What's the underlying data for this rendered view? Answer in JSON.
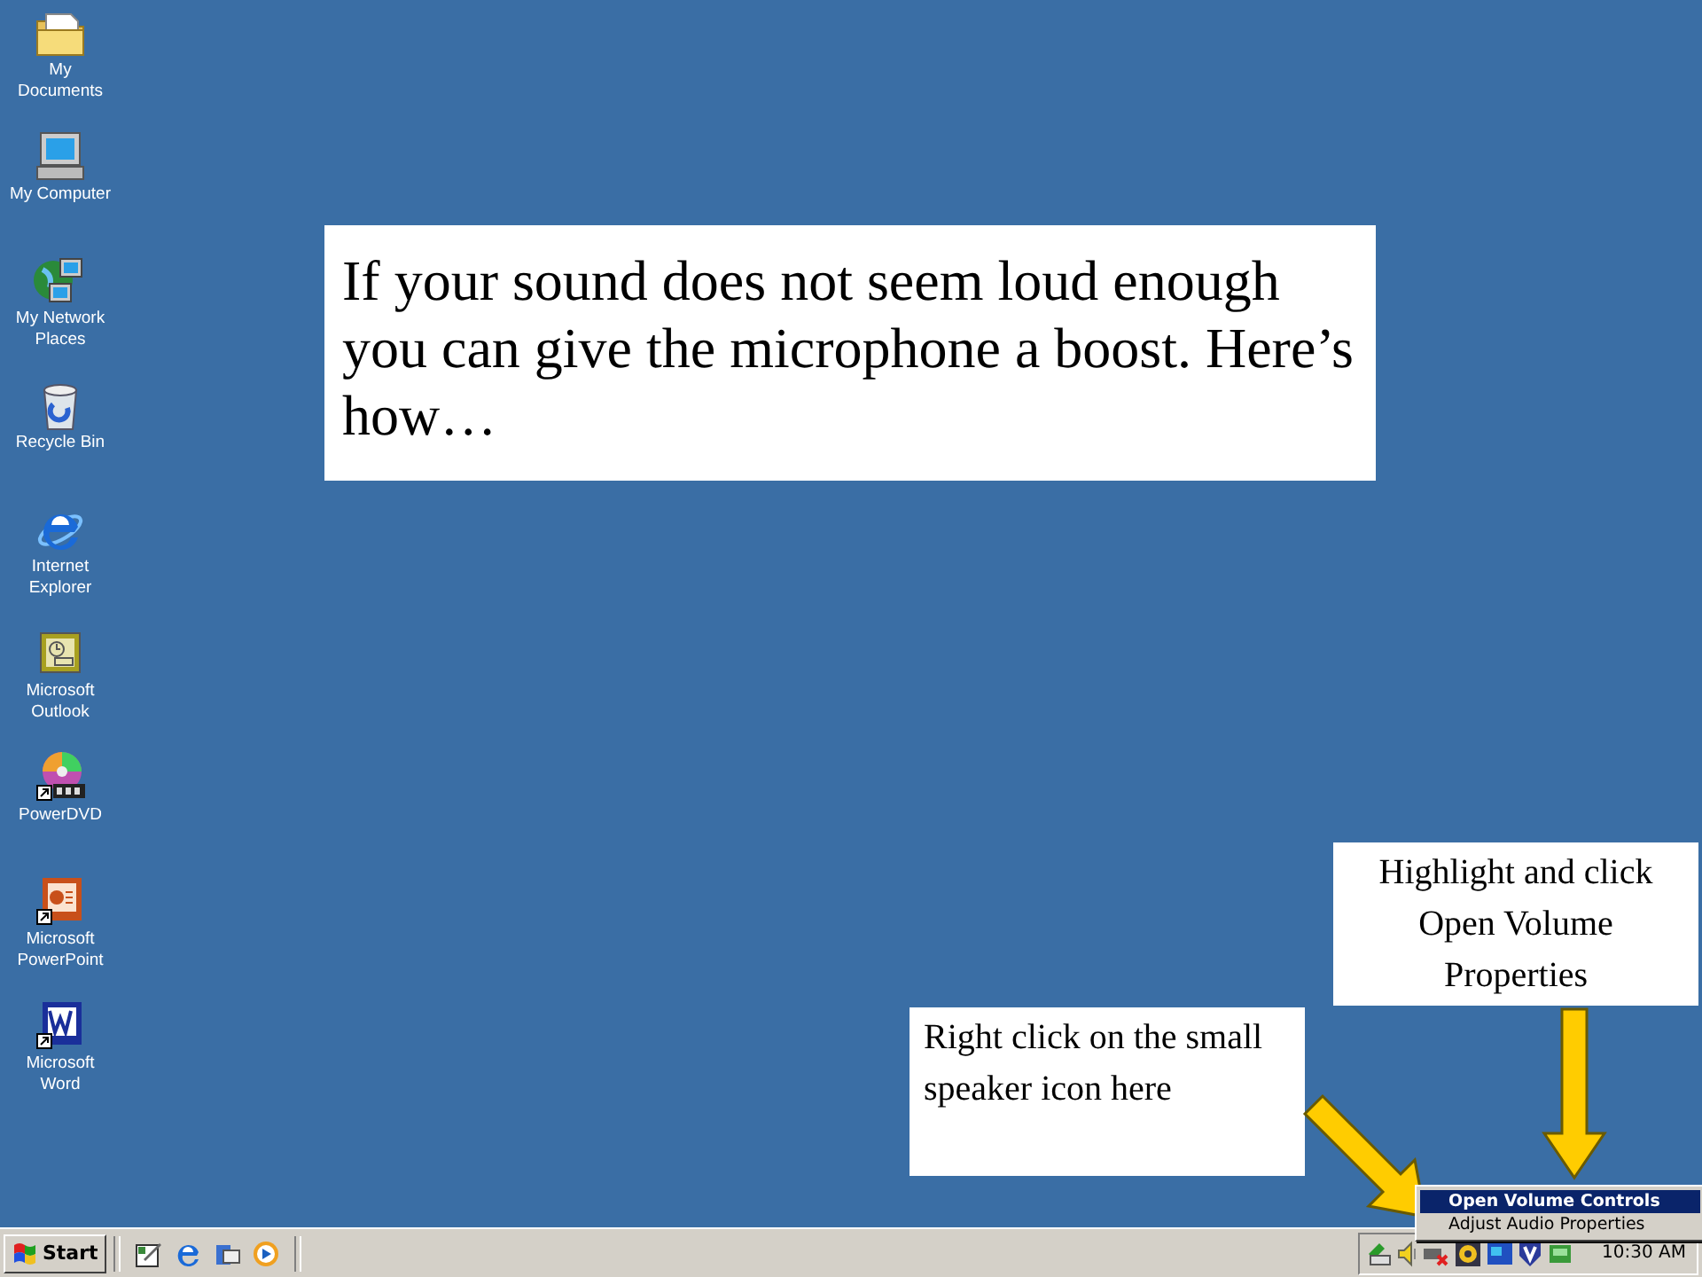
{
  "desktop_icons": [
    {
      "label": "My Documents",
      "kind": "folder"
    },
    {
      "label": "My Computer",
      "kind": "computer"
    },
    {
      "label": "My Network Places",
      "kind": "network"
    },
    {
      "label": "Recycle Bin",
      "kind": "bin"
    },
    {
      "label": "Internet Explorer",
      "kind": "browser"
    },
    {
      "label": "Microsoft Outlook",
      "kind": "outlook"
    },
    {
      "label": "PowerDVD",
      "kind": "dvd"
    },
    {
      "label": "Microsoft PowerPoint",
      "kind": "powerpoint"
    },
    {
      "label": "Microsoft Word",
      "kind": "word"
    }
  ],
  "callouts": [
    {
      "kind": "title",
      "text": "If your sound does not seem loud enough you can give the microphone a boost.  Here’s how…"
    },
    {
      "kind": "menu-hint",
      "text": "Highlight and click Open Volume Properties"
    },
    {
      "kind": "speaker-hint",
      "text": "Right click on the small speaker icon here"
    }
  ],
  "taskbar": {
    "start_button": "Start",
    "clock": "10:30 AM"
  },
  "context_menu": {
    "items": [
      {
        "label": "Open Volume Controls",
        "selected": true
      },
      {
        "label": "Adjust Audio Properties",
        "selected": false
      }
    ]
  }
}
